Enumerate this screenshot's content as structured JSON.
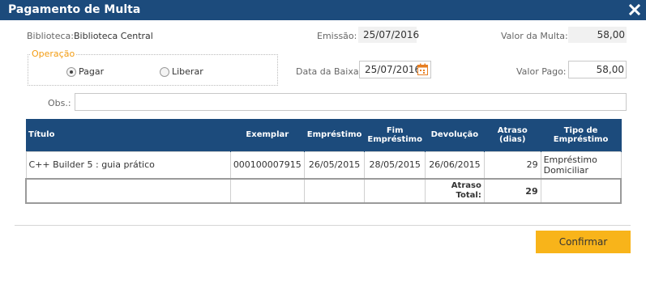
{
  "window": {
    "title": "Pagamento de Multa",
    "close_icon": "close-icon"
  },
  "form": {
    "biblioteca_label": "Biblioteca:",
    "biblioteca_value": "Biblioteca Central",
    "emissao_label": "Emissão:",
    "emissao_value": "25/07/2016",
    "valor_multa_label": "Valor da Multa:",
    "valor_multa_value": "58,00",
    "operacao_label": "Operação",
    "operacao_options": [
      "Pagar",
      "Liberar"
    ],
    "operacao_selected": "Pagar",
    "data_baixa_label": "Data da Baixa:",
    "data_baixa_value": "25/07/2016",
    "valor_pago_label": "Valor Pago:",
    "valor_pago_value": "58,00",
    "obs_label": "Obs.:",
    "obs_value": ""
  },
  "table": {
    "headers": {
      "titulo": "Título",
      "exemplar": "Exemplar",
      "emprestimo": "Empréstimo",
      "fim_line1": "Fim",
      "fim_line2": "Empréstimo",
      "devolucao": "Devolução",
      "atraso": "Atraso (dias)",
      "tipo": "Tipo de Empréstimo"
    },
    "rows": [
      {
        "titulo": "C++ Builder 5 : guia prático",
        "exemplar": "000100007915",
        "emprestimo": "26/05/2015",
        "fim_emprestimo": "28/05/2015",
        "devolucao": "26/06/2015",
        "atraso": "29",
        "tipo_line1": "Empréstimo",
        "tipo_line2": "Domiciliar"
      }
    ],
    "total": {
      "label_line1": "Atraso",
      "label_line2": "Total:",
      "value": "29"
    }
  },
  "actions": {
    "confirm_label": "Confirmar"
  },
  "colors": {
    "header_bg": "#1c4b7c",
    "accent_orange": "#f39c12",
    "confirm_bg": "#f8b41a"
  }
}
